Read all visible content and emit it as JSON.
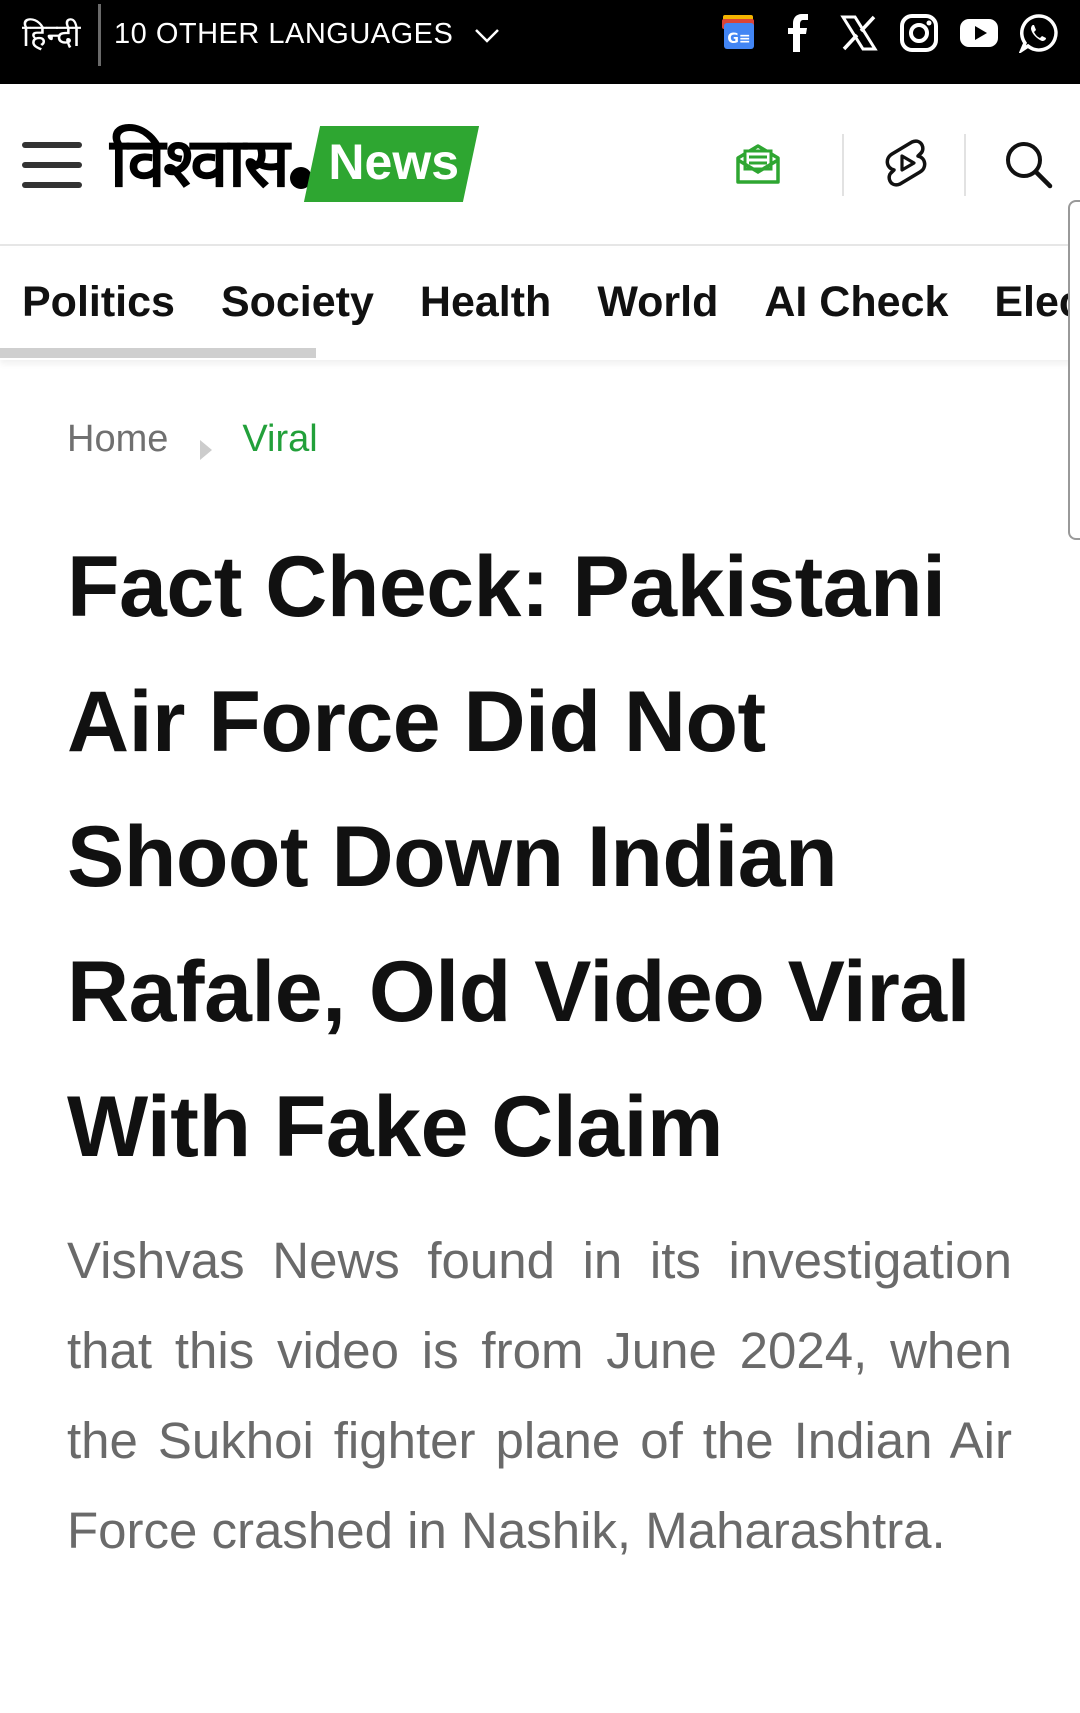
{
  "topbar": {
    "hindi_label": "हिन्दी",
    "other_languages_label": "10 OTHER LANGUAGES",
    "social_icons": [
      "google-news-icon",
      "facebook-icon",
      "x-icon",
      "instagram-icon",
      "youtube-icon",
      "whatsapp-icon"
    ]
  },
  "header": {
    "logo_hindi": "विश्वास",
    "logo_news": "News",
    "icons": [
      "newsletter-icon",
      "shorts-icon",
      "search-icon"
    ]
  },
  "nav": {
    "items": [
      "Politics",
      "Society",
      "Health",
      "World",
      "AI Check",
      "Elect"
    ]
  },
  "breadcrumb": {
    "home": "Home",
    "current": "Viral"
  },
  "article": {
    "headline": "Fact Check: Pakistani Air Force Did Not Shoot Down Indian Rafale, Old Video Viral With Fake Claim",
    "summary": "Vishvas News found in its investigation that this video is from June 2024, when the Sukhoi fighter plane of the Indian Air Force crashed in Nashik, Maharashtra."
  },
  "colors": {
    "brand_green": "#2ea631",
    "breadcrumb_green": "#22a03a",
    "topbar_bg": "#000000"
  }
}
